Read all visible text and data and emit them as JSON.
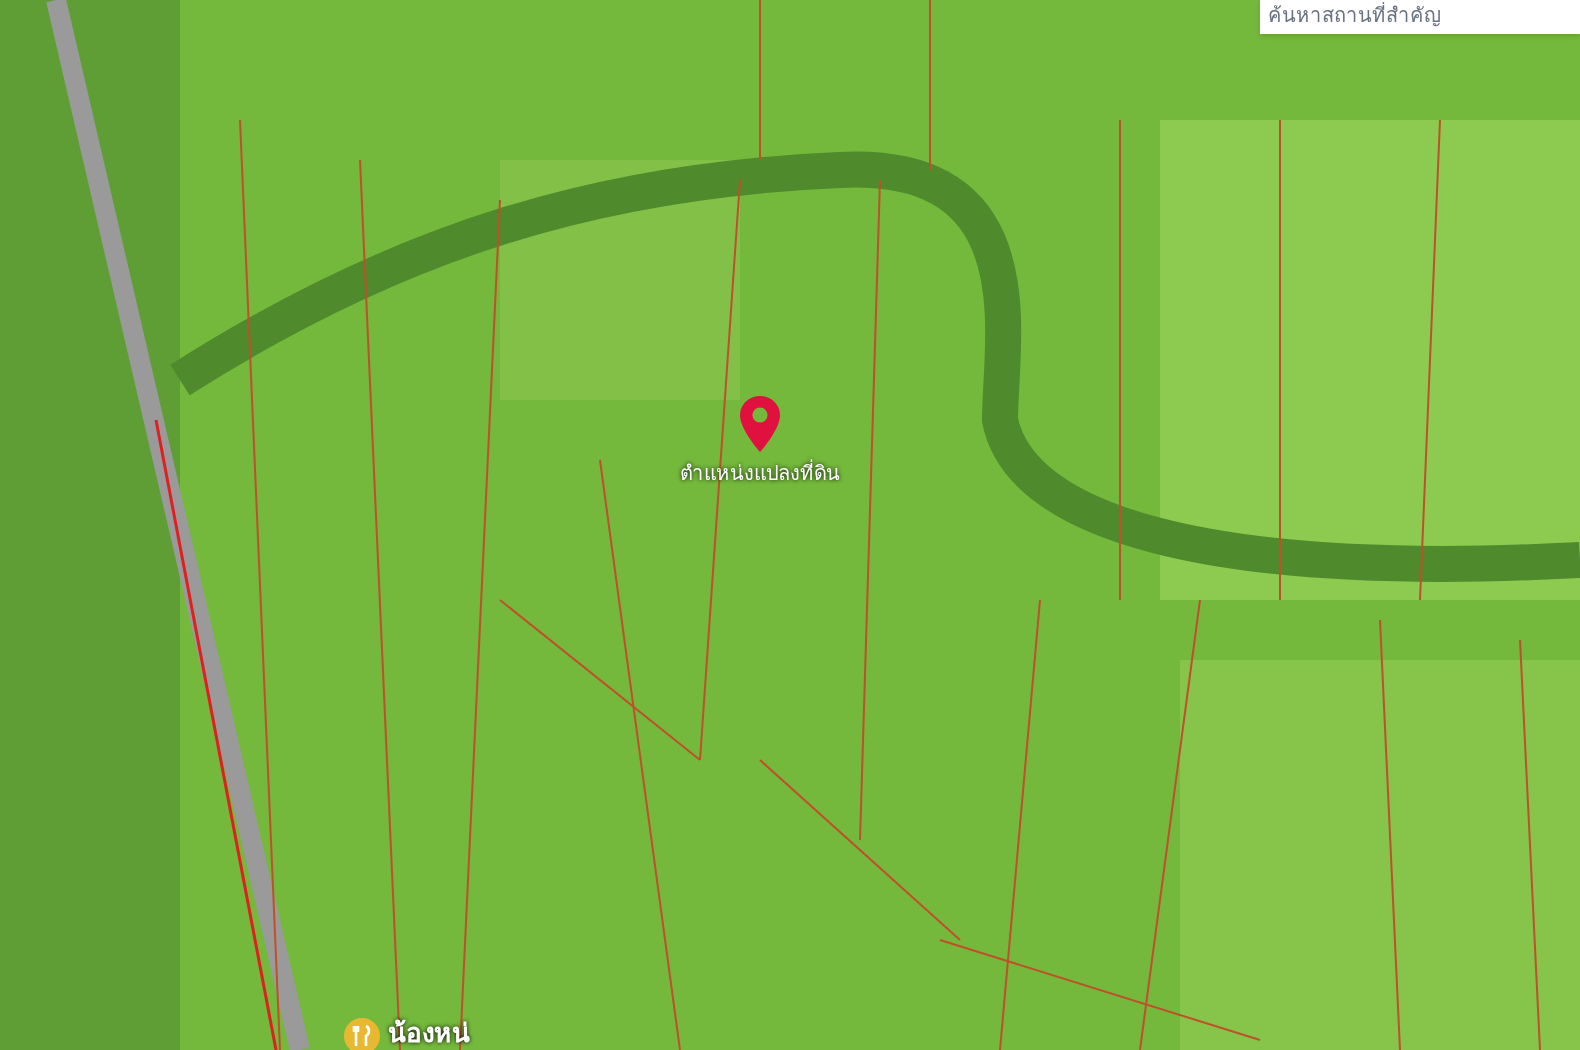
{
  "search": {
    "placeholder": "ค้นหาสถานที่สำคัญ"
  },
  "map": {
    "pins": [
      {
        "kind": "location",
        "label": "ตำแหน่งแปลงที่ดิน"
      },
      {
        "kind": "restaurant",
        "label": "น้องหน่"
      }
    ]
  }
}
